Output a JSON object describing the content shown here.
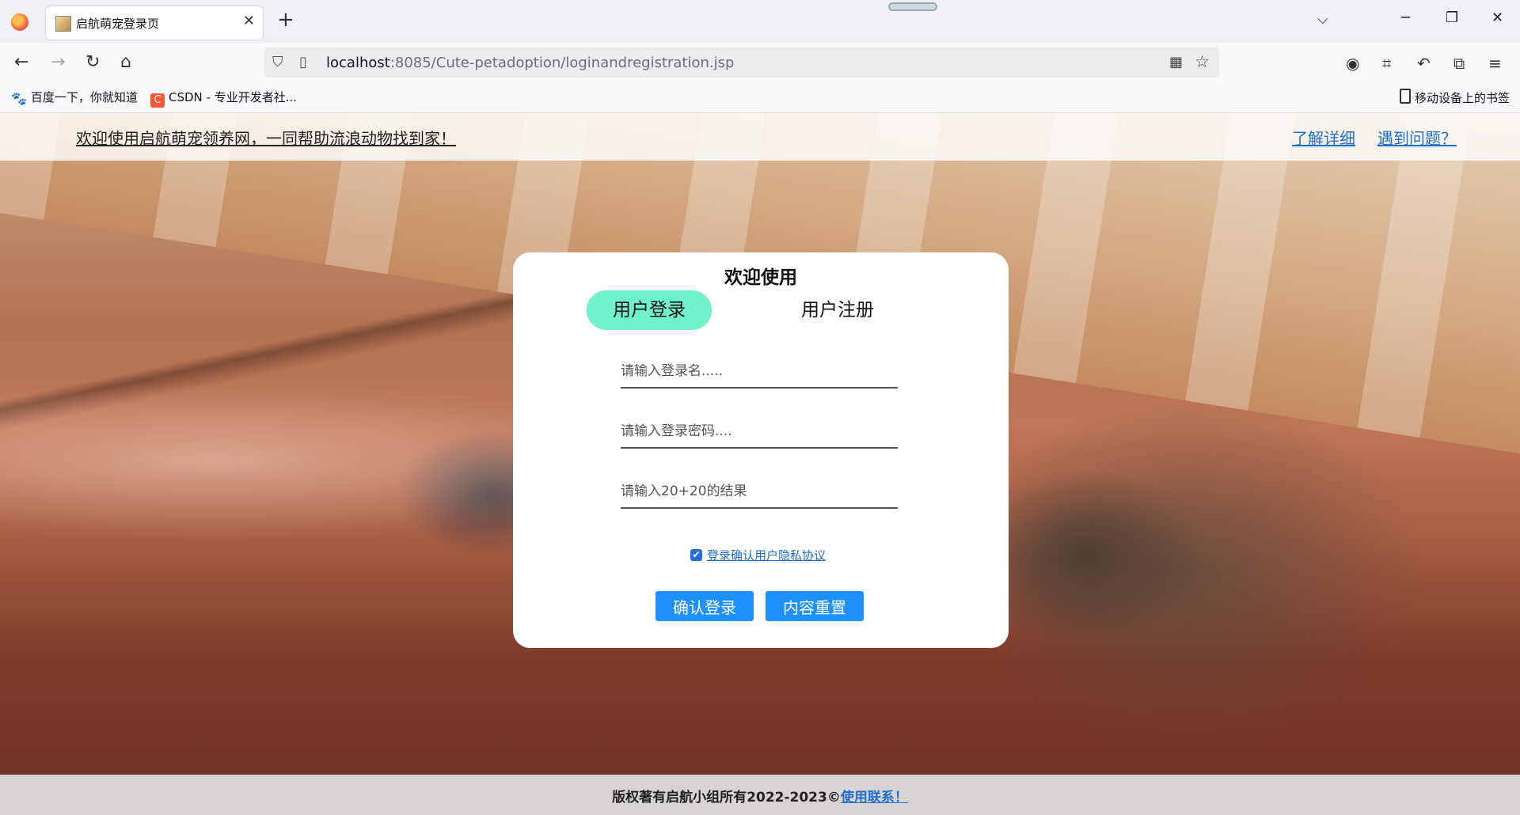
{
  "browser": {
    "tab_title": "启航萌宠登录页",
    "url_host": "localhost",
    "url_rest": ":8085/Cute-petadoption/loginandregistration.jsp",
    "bookmarks": [
      {
        "label": "百度一下，你就知道",
        "icon": "baidu-paw-icon"
      },
      {
        "label": "CSDN - 专业开发者社...",
        "icon": "csdn-icon"
      }
    ],
    "mobile_bookmarks": "移动设备上的书签"
  },
  "header": {
    "welcome": "欢迎使用启航萌宠领养网，一同帮助流浪动物找到家！",
    "learn_more": "了解详细",
    "help": "遇到问题？"
  },
  "login": {
    "title": "欢迎使用",
    "tab_login": "用户登录",
    "tab_register": "用户注册",
    "username_placeholder": "请输入登录名.....",
    "password_placeholder": "请输入登录密码....",
    "captcha_placeholder": "请输入20+20的结果",
    "agree_checked": true,
    "agree_label": "登录确认用户隐私协议",
    "submit": "确认登录",
    "reset": "内容重置"
  },
  "footer": {
    "copyright": "版权著有启航小组所有2022-2023©",
    "contact": "使用联系！"
  },
  "colors": {
    "active_tab": "#6ff1c9",
    "button": "#1e90ff",
    "link": "#1f6fd1"
  }
}
